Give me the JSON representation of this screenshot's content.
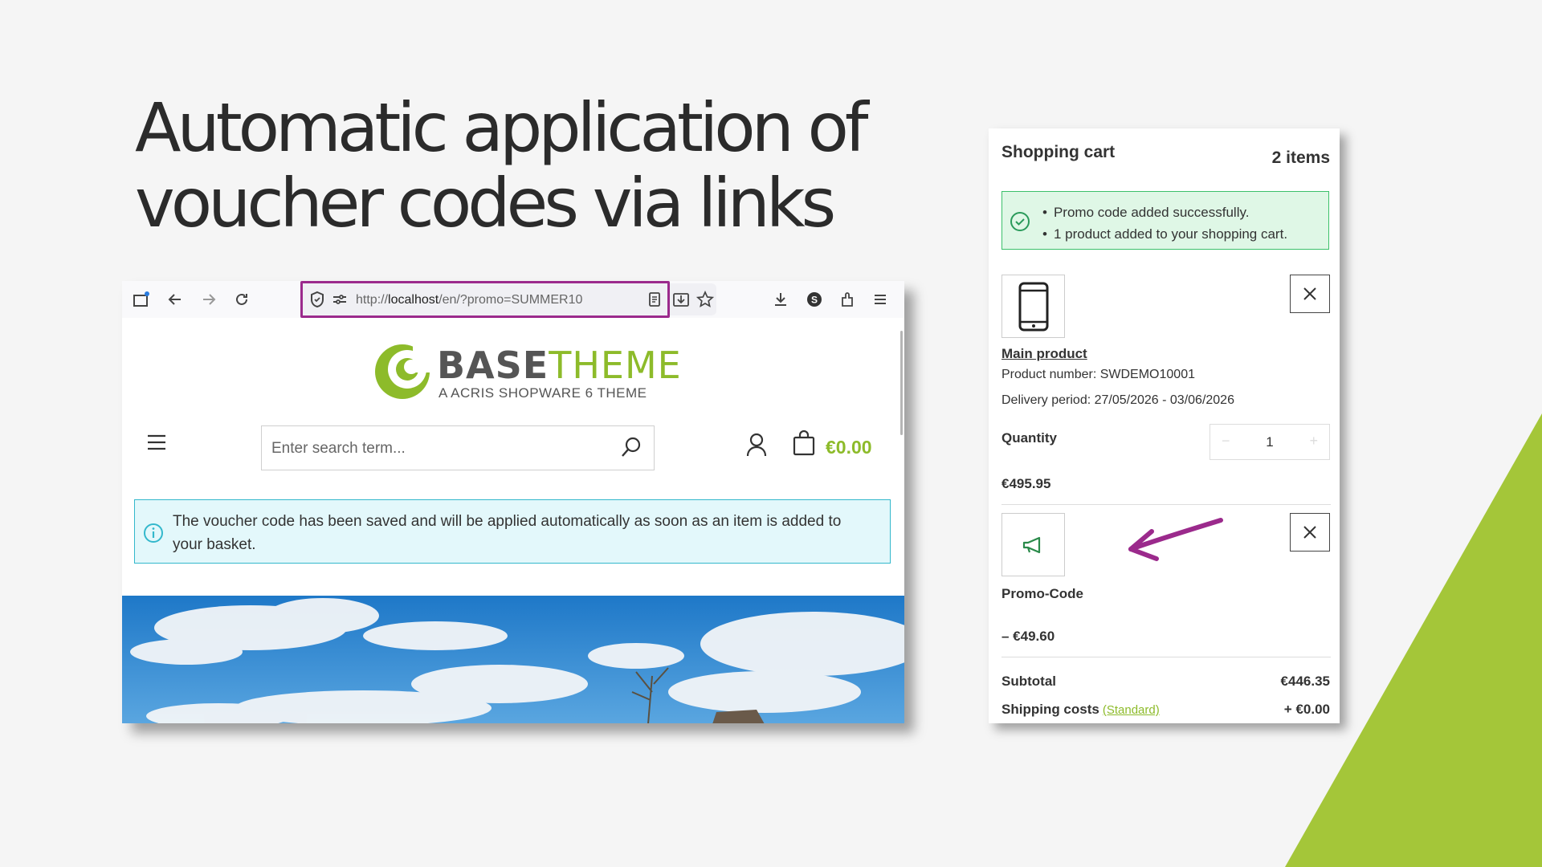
{
  "slide": {
    "title_line1": "Automatic application of",
    "title_line2": "voucher codes via links",
    "accent_color": "#a4c639"
  },
  "browser": {
    "url_prefix": "http://",
    "url_host": "localhost",
    "url_rest": "/en/?promo=SUMMER10",
    "logo_name_bold": "BASE",
    "logo_name_light": "THEME",
    "logo_sub": "A ACRIS SHOPWARE 6 THEME",
    "search_placeholder": "Enter search term...",
    "cart_total": "€0.00",
    "info_message": "The voucher code has been saved and will be applied automatically as soon as an item is added to your basket."
  },
  "cart": {
    "title": "Shopping cart",
    "count": "2 items",
    "success_messages": [
      "Promo code added successfully.",
      "1 product added to your shopping cart."
    ],
    "product": {
      "name": "Main product",
      "number": "Product number: SWDEMO10001",
      "delivery": "Delivery period: 27/05/2026 - 03/06/2026",
      "quantity_label": "Quantity",
      "quantity": "1",
      "price": "€495.95"
    },
    "promo": {
      "label": "Promo-Code",
      "value": "– €49.60"
    },
    "subtotal_label": "Subtotal",
    "subtotal": "€446.35",
    "shipping_label": "Shipping costs",
    "shipping_method": "(Standard)",
    "shipping": "+ €0.00"
  },
  "colors": {
    "brand_green": "#8dbb2a",
    "highlight_purple": "#9b2a8c",
    "info_border": "#33b8cc",
    "success_border": "#3cc06a"
  }
}
